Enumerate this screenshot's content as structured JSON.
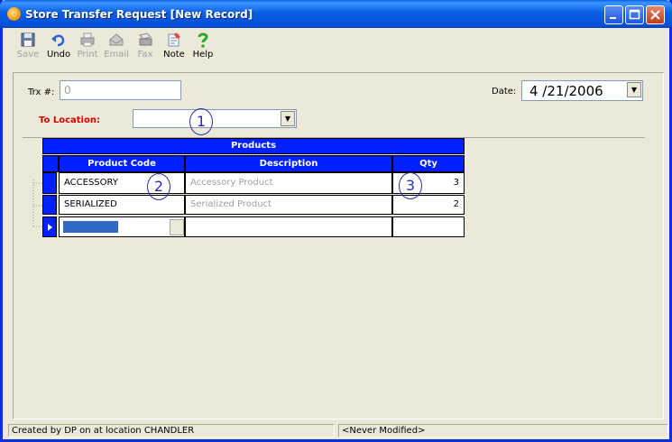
{
  "window": {
    "title": "Store Transfer Request [New Record]",
    "controls": [
      "minimize-icon",
      "maximize-icon",
      "close-icon"
    ]
  },
  "toolbar": {
    "items": [
      {
        "label": "Save",
        "icon": "floppy-disk-icon",
        "enabled": false
      },
      {
        "label": "Undo",
        "icon": "undo-arrow-icon",
        "enabled": true
      },
      {
        "label": "Print",
        "icon": "printer-icon",
        "enabled": false
      },
      {
        "label": "Email",
        "icon": "email-icon",
        "enabled": false
      },
      {
        "label": "Fax",
        "icon": "fax-icon",
        "enabled": false
      },
      {
        "label": "Note",
        "icon": "note-icon",
        "enabled": true
      },
      {
        "label": "Help",
        "icon": "help-question-icon",
        "enabled": true
      }
    ]
  },
  "form": {
    "trx_label": "Trx #:",
    "trx_value": "0",
    "date_label": "Date:",
    "date_value": "4 /21/2006",
    "to_location_label": "To Location:",
    "to_location_value": ""
  },
  "grid": {
    "title": "Products",
    "columns": [
      "Product Code",
      "Description",
      "Qty"
    ],
    "rows": [
      {
        "code": "ACCESSORY",
        "description": "Accessory Product",
        "qty": "3"
      },
      {
        "code": "SERIALIZED",
        "description": "Serialized Product",
        "qty": "2"
      }
    ]
  },
  "callouts": [
    "1",
    "2",
    "3"
  ],
  "status": {
    "left": "Created by DP on  at location CHANDLER",
    "right": "<Never Modified>"
  },
  "colors": {
    "grid_header": "#0020ff",
    "title_bar": "#0450d9",
    "to_location_label": "#d40000",
    "callout": "#2b2fae"
  }
}
